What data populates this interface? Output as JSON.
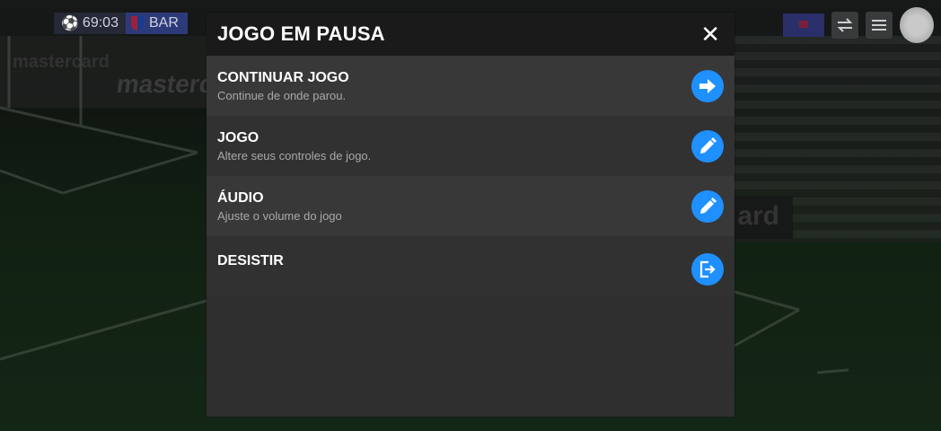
{
  "hud": {
    "time": "69:03",
    "team": "BAR"
  },
  "backdrop": {
    "board_left": "mastercard",
    "board_right": "ard"
  },
  "modal": {
    "title": "JOGO EM PAUSA",
    "close_icon": "close-icon",
    "items": [
      {
        "label": "CONTINUAR JOGO",
        "description": "Continue de onde parou.",
        "icon": "arrow-right-icon"
      },
      {
        "label": "JOGO",
        "description": "Altere seus controles de jogo.",
        "icon": "pencil-icon"
      },
      {
        "label": "ÁUDIO",
        "description": "Ajuste o volume do jogo",
        "icon": "pencil-icon"
      },
      {
        "label": "DESISTIR",
        "description": "",
        "icon": "exit-icon"
      }
    ]
  },
  "colors": {
    "accent": "#1e90ff",
    "header": "#1a1a1a",
    "panel": "#2f2f2f"
  }
}
